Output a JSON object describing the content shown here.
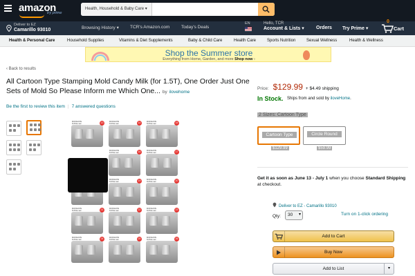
{
  "header": {
    "logo": "amazon",
    "logo_sub": "try prime",
    "search_category": "Health, Household & Baby Care",
    "deliver_line1": "Deliver to EZ",
    "deliver_line2": "Camarillo 93010",
    "nav_links": [
      "Browsing History",
      "TCR's Amazon.com",
      "Today's Deals"
    ],
    "lang": "EN",
    "account_hello": "Hello, TCR",
    "account_label": "Account & Lists",
    "orders": "Orders",
    "try_prime": "Try Prime",
    "cart_count": "0",
    "cart_label": "Cart"
  },
  "subnav": [
    "Health & Personal Care",
    "Household Supplies",
    "Vitamins & Diet Supplements",
    "Baby & Child Care",
    "Health Care",
    "Sports Nutrition",
    "Sexual Wellness",
    "Health & Wellness"
  ],
  "banner": {
    "headline": "Shop the Summer store",
    "sub": "Everything from Home, Garden, and more",
    "cta": "Shop now"
  },
  "back_link": "Back to results",
  "product": {
    "title": "All Cartoon Type Stamping Mold Candy Milk (for 1.5T), One Order Just One Sets of Mold So Please Inform me Which One...",
    "by": "by",
    "brand": "ilovehome",
    "review_link": "Be the first to review this item",
    "questions_link": "7 answered questions",
    "tile_numbers": [
      "13",
      "14",
      "15",
      "16",
      "17",
      "18",
      "19",
      "20",
      "21",
      "22",
      "23",
      "24",
      "25",
      "26",
      "27"
    ]
  },
  "buybox": {
    "price_label": "Price:",
    "price": "$129.99",
    "shipping": "+ $4.49 shipping",
    "stock": "In Stock.",
    "ships_from": "Ships from and sold by",
    "seller": "iloveHome",
    "size_label": "2 Sizes: Cartoon Type",
    "options": [
      {
        "label": "Cartoon Type",
        "price": "$129.99"
      },
      {
        "label": "Circle Round",
        "price": "$59.99"
      }
    ],
    "delivery_lead": "Get it as soon as",
    "delivery_dates": "June 13 - July 1",
    "delivery_mid": "when you choose",
    "delivery_option": "Standard Shipping",
    "delivery_end": "at checkout.",
    "deliver_to": "Deliver to EZ - Camarillo 93010",
    "qty_label": "Qty:",
    "qty_value": "30",
    "one_click": "Turn on 1-click ordering",
    "add_to_cart": "Add to Cart",
    "buy_now": "Buy Now",
    "add_to_list": "Add to List"
  }
}
